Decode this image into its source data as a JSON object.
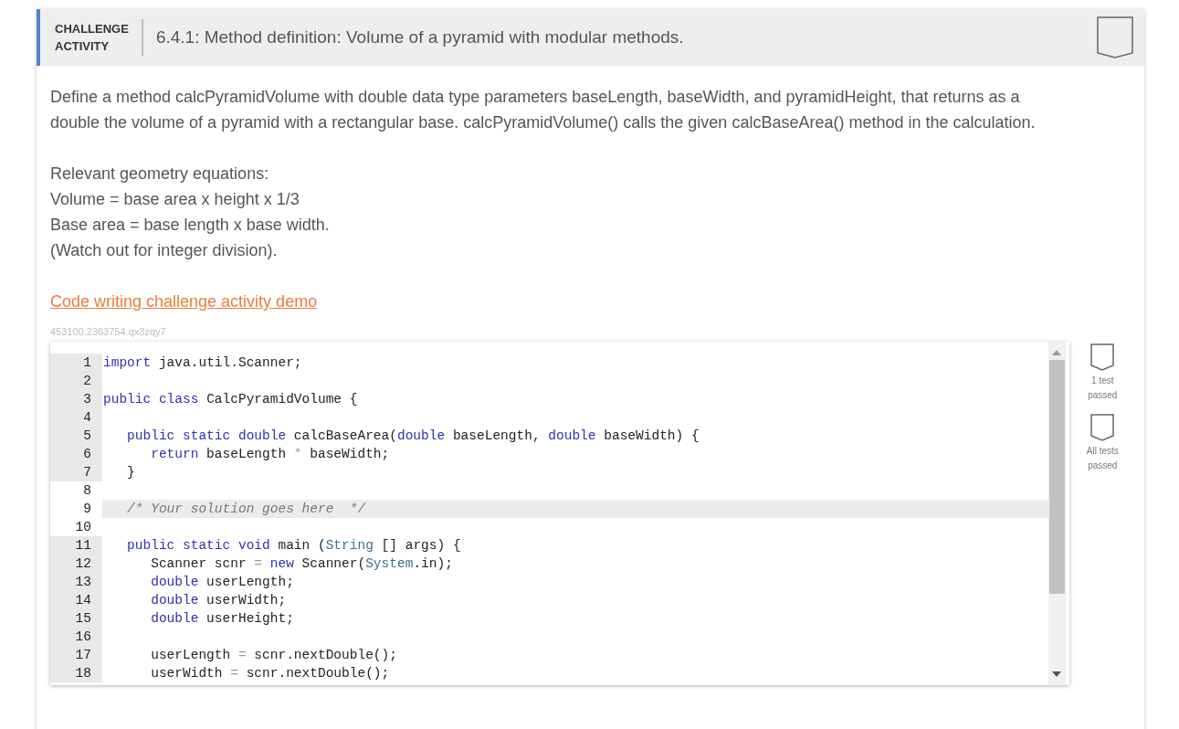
{
  "header": {
    "label_line1": "CHALLENGE",
    "label_line2": "ACTIVITY",
    "title": "6.4.1: Method definition: Volume of a pyramid with modular methods.",
    "completed": false
  },
  "description": "Define a method calcPyramidVolume with double data type parameters baseLength, baseWidth, and pyramidHeight, that returns as a double the volume of a pyramid with a rectangular base. calcPyramidVolume() calls the given calcBaseArea() method in the calculation.",
  "equations": [
    "Relevant geometry equations:",
    "Volume = base area x height x 1/3",
    "Base area = base length x base width.",
    "(Watch out for integer division)."
  ],
  "demo_link": "Code writing challenge activity demo",
  "activity_id": "453100.2363754.qx3zqy7",
  "editor": {
    "lines": [
      {
        "number": "1",
        "readonly": true,
        "active": false,
        "tokens": [
          {
            "kind": "keyword",
            "text": "import"
          },
          {
            "kind": "text",
            "text": " java.util.Scanner;"
          }
        ]
      },
      {
        "number": "2",
        "readonly": true,
        "active": false
      },
      {
        "number": "3",
        "readonly": true,
        "active": false,
        "tokens": [
          {
            "kind": "keyword",
            "text": "public"
          },
          {
            "kind": "keyword",
            "text": " class"
          },
          {
            "kind": "text",
            "text": " CalcPyramidVolume {"
          }
        ]
      },
      {
        "number": "4",
        "readonly": true,
        "active": false
      },
      {
        "number": "5",
        "readonly": true,
        "active": false,
        "tokens": [
          {
            "kind": "keyword",
            "text": "   public static double"
          },
          {
            "kind": "text",
            "text": " calcBaseArea("
          },
          {
            "kind": "keyword",
            "text": "double"
          },
          {
            "kind": "text",
            "text": " baseLength, "
          },
          {
            "kind": "keyword",
            "text": "double"
          },
          {
            "kind": "text",
            "text": " baseWidth) {"
          }
        ]
      },
      {
        "number": "6",
        "readonly": true,
        "active": false,
        "tokens": [
          {
            "kind": "keyword",
            "text": "      return"
          },
          {
            "kind": "text",
            "text": " baseLength "
          },
          {
            "kind": "operator",
            "text": "*"
          },
          {
            "kind": "text",
            "text": " baseWidth;"
          }
        ]
      },
      {
        "number": "7",
        "readonly": true,
        "active": false,
        "tokens": [
          {
            "kind": "text",
            "text": "   }"
          }
        ]
      },
      {
        "number": "8",
        "readonly": false,
        "active": false
      },
      {
        "number": "9",
        "readonly": false,
        "active": true,
        "tokens": [
          {
            "kind": "comment",
            "text": "   /* Your solution goes here  */"
          }
        ]
      },
      {
        "number": "10",
        "readonly": false,
        "active": false
      },
      {
        "number": "11",
        "readonly": true,
        "active": false,
        "tokens": [
          {
            "kind": "keyword",
            "text": "   public static void"
          },
          {
            "kind": "text",
            "text": " main ("
          },
          {
            "kind": "builtin",
            "text": "String"
          },
          {
            "kind": "text",
            "text": " [] args) {"
          }
        ]
      },
      {
        "number": "12",
        "readonly": true,
        "active": false,
        "tokens": [
          {
            "kind": "text",
            "text": "      Scanner scnr "
          },
          {
            "kind": "operator",
            "text": "="
          },
          {
            "kind": "keyword",
            "text": " new"
          },
          {
            "kind": "text",
            "text": " Scanner("
          },
          {
            "kind": "builtin",
            "text": "System"
          },
          {
            "kind": "text",
            "text": ".in);"
          }
        ]
      },
      {
        "number": "13",
        "readonly": true,
        "active": false,
        "tokens": [
          {
            "kind": "keyword",
            "text": "      double"
          },
          {
            "kind": "text",
            "text": " userLength;"
          }
        ]
      },
      {
        "number": "14",
        "readonly": true,
        "active": false,
        "tokens": [
          {
            "kind": "keyword",
            "text": "      double"
          },
          {
            "kind": "text",
            "text": " userWidth;"
          }
        ]
      },
      {
        "number": "15",
        "readonly": true,
        "active": false,
        "tokens": [
          {
            "kind": "keyword",
            "text": "      double"
          },
          {
            "kind": "text",
            "text": " userHeight;"
          }
        ]
      },
      {
        "number": "16",
        "readonly": true,
        "active": false
      },
      {
        "number": "17",
        "readonly": true,
        "active": false,
        "tokens": [
          {
            "kind": "text",
            "text": "      userLength "
          },
          {
            "kind": "operator",
            "text": "="
          },
          {
            "kind": "text",
            "text": " scnr.nextDouble();"
          }
        ]
      },
      {
        "number": "18",
        "readonly": true,
        "active": false,
        "tokens": [
          {
            "kind": "text",
            "text": "      userWidth "
          },
          {
            "kind": "operator",
            "text": "="
          },
          {
            "kind": "text",
            "text": " scnr.nextDouble();"
          }
        ]
      }
    ]
  },
  "tests": [
    {
      "label_line1": "1 test",
      "label_line2": "passed",
      "passed": false
    },
    {
      "label_line1": "All tests",
      "label_line2": "passed",
      "passed": false
    }
  ]
}
